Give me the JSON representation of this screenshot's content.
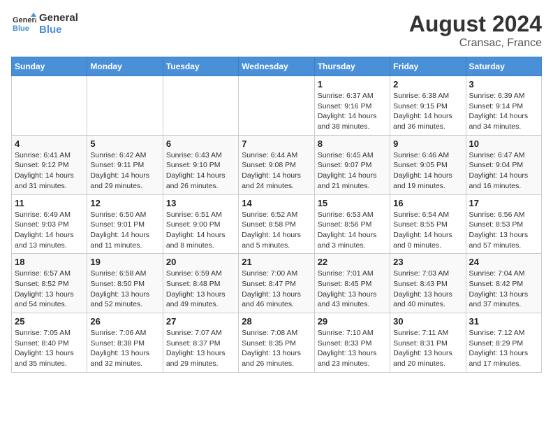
{
  "header": {
    "logo_line1": "General",
    "logo_line2": "Blue",
    "month_year": "August 2024",
    "location": "Cransac, France"
  },
  "weekdays": [
    "Sunday",
    "Monday",
    "Tuesday",
    "Wednesday",
    "Thursday",
    "Friday",
    "Saturday"
  ],
  "weeks": [
    [
      {
        "day": "",
        "info": ""
      },
      {
        "day": "",
        "info": ""
      },
      {
        "day": "",
        "info": ""
      },
      {
        "day": "",
        "info": ""
      },
      {
        "day": "1",
        "info": "Sunrise: 6:37 AM\nSunset: 9:16 PM\nDaylight: 14 hours\nand 38 minutes."
      },
      {
        "day": "2",
        "info": "Sunrise: 6:38 AM\nSunset: 9:15 PM\nDaylight: 14 hours\nand 36 minutes."
      },
      {
        "day": "3",
        "info": "Sunrise: 6:39 AM\nSunset: 9:14 PM\nDaylight: 14 hours\nand 34 minutes."
      }
    ],
    [
      {
        "day": "4",
        "info": "Sunrise: 6:41 AM\nSunset: 9:12 PM\nDaylight: 14 hours\nand 31 minutes."
      },
      {
        "day": "5",
        "info": "Sunrise: 6:42 AM\nSunset: 9:11 PM\nDaylight: 14 hours\nand 29 minutes."
      },
      {
        "day": "6",
        "info": "Sunrise: 6:43 AM\nSunset: 9:10 PM\nDaylight: 14 hours\nand 26 minutes."
      },
      {
        "day": "7",
        "info": "Sunrise: 6:44 AM\nSunset: 9:08 PM\nDaylight: 14 hours\nand 24 minutes."
      },
      {
        "day": "8",
        "info": "Sunrise: 6:45 AM\nSunset: 9:07 PM\nDaylight: 14 hours\nand 21 minutes."
      },
      {
        "day": "9",
        "info": "Sunrise: 6:46 AM\nSunset: 9:05 PM\nDaylight: 14 hours\nand 19 minutes."
      },
      {
        "day": "10",
        "info": "Sunrise: 6:47 AM\nSunset: 9:04 PM\nDaylight: 14 hours\nand 16 minutes."
      }
    ],
    [
      {
        "day": "11",
        "info": "Sunrise: 6:49 AM\nSunset: 9:03 PM\nDaylight: 14 hours\nand 13 minutes."
      },
      {
        "day": "12",
        "info": "Sunrise: 6:50 AM\nSunset: 9:01 PM\nDaylight: 14 hours\nand 11 minutes."
      },
      {
        "day": "13",
        "info": "Sunrise: 6:51 AM\nSunset: 9:00 PM\nDaylight: 14 hours\nand 8 minutes."
      },
      {
        "day": "14",
        "info": "Sunrise: 6:52 AM\nSunset: 8:58 PM\nDaylight: 14 hours\nand 5 minutes."
      },
      {
        "day": "15",
        "info": "Sunrise: 6:53 AM\nSunset: 8:56 PM\nDaylight: 14 hours\nand 3 minutes."
      },
      {
        "day": "16",
        "info": "Sunrise: 6:54 AM\nSunset: 8:55 PM\nDaylight: 14 hours\nand 0 minutes."
      },
      {
        "day": "17",
        "info": "Sunrise: 6:56 AM\nSunset: 8:53 PM\nDaylight: 13 hours\nand 57 minutes."
      }
    ],
    [
      {
        "day": "18",
        "info": "Sunrise: 6:57 AM\nSunset: 8:52 PM\nDaylight: 13 hours\nand 54 minutes."
      },
      {
        "day": "19",
        "info": "Sunrise: 6:58 AM\nSunset: 8:50 PM\nDaylight: 13 hours\nand 52 minutes."
      },
      {
        "day": "20",
        "info": "Sunrise: 6:59 AM\nSunset: 8:48 PM\nDaylight: 13 hours\nand 49 minutes."
      },
      {
        "day": "21",
        "info": "Sunrise: 7:00 AM\nSunset: 8:47 PM\nDaylight: 13 hours\nand 46 minutes."
      },
      {
        "day": "22",
        "info": "Sunrise: 7:01 AM\nSunset: 8:45 PM\nDaylight: 13 hours\nand 43 minutes."
      },
      {
        "day": "23",
        "info": "Sunrise: 7:03 AM\nSunset: 8:43 PM\nDaylight: 13 hours\nand 40 minutes."
      },
      {
        "day": "24",
        "info": "Sunrise: 7:04 AM\nSunset: 8:42 PM\nDaylight: 13 hours\nand 37 minutes."
      }
    ],
    [
      {
        "day": "25",
        "info": "Sunrise: 7:05 AM\nSunset: 8:40 PM\nDaylight: 13 hours\nand 35 minutes."
      },
      {
        "day": "26",
        "info": "Sunrise: 7:06 AM\nSunset: 8:38 PM\nDaylight: 13 hours\nand 32 minutes."
      },
      {
        "day": "27",
        "info": "Sunrise: 7:07 AM\nSunset: 8:37 PM\nDaylight: 13 hours\nand 29 minutes."
      },
      {
        "day": "28",
        "info": "Sunrise: 7:08 AM\nSunset: 8:35 PM\nDaylight: 13 hours\nand 26 minutes."
      },
      {
        "day": "29",
        "info": "Sunrise: 7:10 AM\nSunset: 8:33 PM\nDaylight: 13 hours\nand 23 minutes."
      },
      {
        "day": "30",
        "info": "Sunrise: 7:11 AM\nSunset: 8:31 PM\nDaylight: 13 hours\nand 20 minutes."
      },
      {
        "day": "31",
        "info": "Sunrise: 7:12 AM\nSunset: 8:29 PM\nDaylight: 13 hours\nand 17 minutes."
      }
    ]
  ]
}
